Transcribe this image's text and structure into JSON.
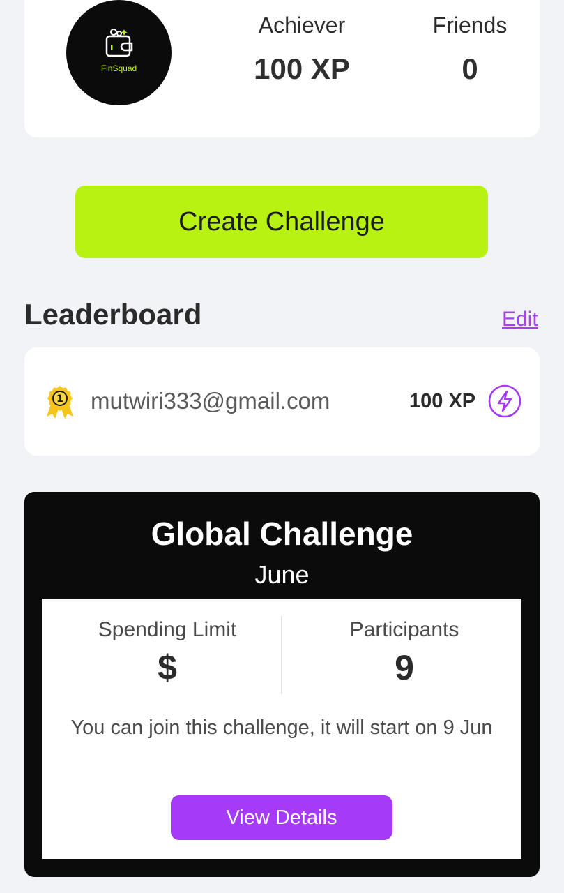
{
  "profile": {
    "logo_text": "FinSquad",
    "rank_label": "Achiever",
    "xp_value": "100 XP",
    "friends_label": "Friends",
    "friends_value": "0"
  },
  "create_challenge": {
    "label": "Create Challenge"
  },
  "leaderboard": {
    "title": "Leaderboard",
    "edit_label": "Edit",
    "entries": [
      {
        "rank": 1,
        "email": "mutwiri333@gmail.com",
        "xp": "100 XP",
        "badge_icon": "medal-icon",
        "xp_icon": "lightning-icon"
      }
    ]
  },
  "global_challenge": {
    "title": "Global Challenge",
    "month": "June",
    "spending_limit_label": "Spending Limit",
    "spending_limit_value": "$",
    "participants_label": "Participants",
    "participants_value": "9",
    "note": "You can join this challenge, it will start on 9 Jun",
    "button_label": "View Details"
  },
  "colors": {
    "accent_green": "#b7f213",
    "accent_purple": "#a53bf6",
    "background": "#f2f3f7"
  }
}
